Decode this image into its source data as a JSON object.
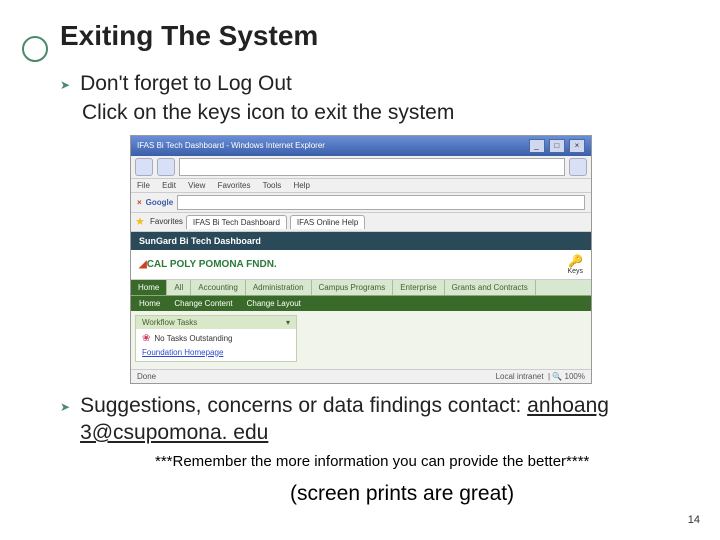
{
  "title": "Exiting The System",
  "bullet1": "Don't forget to Log Out",
  "sub1": "Click on the keys icon to exit the system",
  "browser": {
    "windowTitle": "IFAS Bi Tech Dashboard - Windows Internet Explorer",
    "menu": {
      "file": "File",
      "edit": "Edit",
      "view": "View",
      "favorites": "Favorites",
      "tools": "Tools",
      "help": "Help"
    },
    "google": "Google",
    "favLabel": "Favorites",
    "tab1": "IFAS Bi Tech Dashboard",
    "tab2": "IFAS Online Help",
    "darkbar": "SunGard Bi Tech Dashboard",
    "logo": "CAL POLY POMONA FNDN.",
    "keyLabel": "Keys",
    "navtabs": {
      "home": "Home",
      "all": "All",
      "accounting": "Accounting",
      "admin": "Administration",
      "campus": "Campus Programs",
      "enterprise": "Enterprise",
      "grants": "Grants and Contracts"
    },
    "subtabs": {
      "home": "Home",
      "cc": "Change Content",
      "cl": "Change Layout"
    },
    "panelTitle": "Workflow Tasks",
    "panelRow": "No Tasks Outstanding",
    "panelLink": "Foundation Homepage",
    "statusDone": "Done",
    "statusZone": "Local intranet",
    "statusZoom": "100%"
  },
  "bullet2a": "Suggestions, concerns or data findings contact: ",
  "bullet2email": "anhoang 3@csupomona. edu",
  "reminder": "***Remember the more information you can provide the better****",
  "screenprints": "(screen prints are great)",
  "pagenum": "14"
}
